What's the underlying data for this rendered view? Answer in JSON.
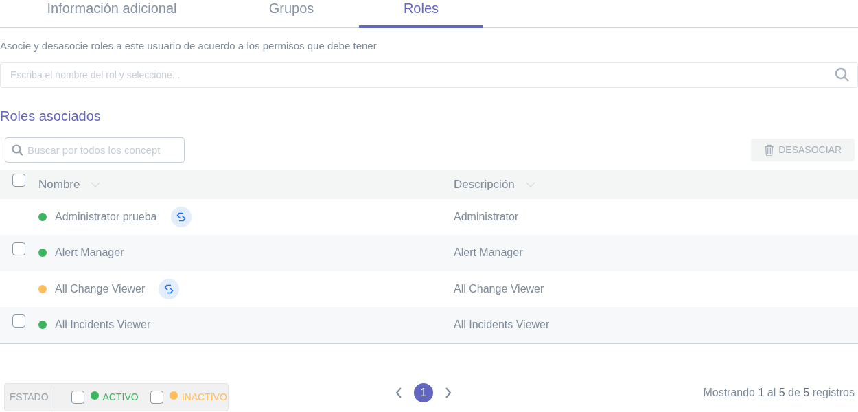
{
  "tabs": [
    {
      "label": "Información adicional",
      "selected": false
    },
    {
      "label": "Grupos",
      "selected": false
    },
    {
      "label": "Roles",
      "selected": true
    }
  ],
  "intro": "Asocie y desasocie roles a este usuario de acuerdo a los permisos que debe tener",
  "role_search": {
    "placeholder": "Escriba el nombre del rol y seleccione..."
  },
  "section_title": "Roles asociados",
  "filter": {
    "placeholder": "Buscar por todos los concept"
  },
  "unlink_button": {
    "label": "DESASOCIAR",
    "disabled": true
  },
  "table": {
    "select_all": {
      "checked": false
    },
    "columns": [
      {
        "label": "Nombre"
      },
      {
        "label": "Descripción"
      }
    ],
    "rows": [
      {
        "kind": "synced",
        "color": "#3cb55f",
        "name": "Administrator prueba",
        "description": "Administrator"
      },
      {
        "kind": "selectable",
        "checked": false,
        "color": "#3cb55f",
        "name": "Alert Manager",
        "description": "Alert Manager"
      },
      {
        "kind": "synced",
        "color": "#ffbd5c",
        "name": "All Change Viewer",
        "description": "All Change Viewer"
      },
      {
        "kind": "selectable",
        "checked": false,
        "color": "#3cb55f",
        "name": "All Incidents Viewer",
        "description": "All Incidents Viewer"
      }
    ]
  },
  "status_filter": {
    "label": "ESTADO",
    "options": [
      {
        "label": "ACTIVO",
        "checked": false,
        "color": "#3cb55f"
      },
      {
        "label": "INACTIVO",
        "checked": false,
        "color": "#ffbd5c"
      }
    ]
  },
  "pagination": {
    "pages": [
      {
        "label": "1",
        "selected": true
      }
    ]
  },
  "summary": "Mostrando **1** al **5** de **5** registros"
}
